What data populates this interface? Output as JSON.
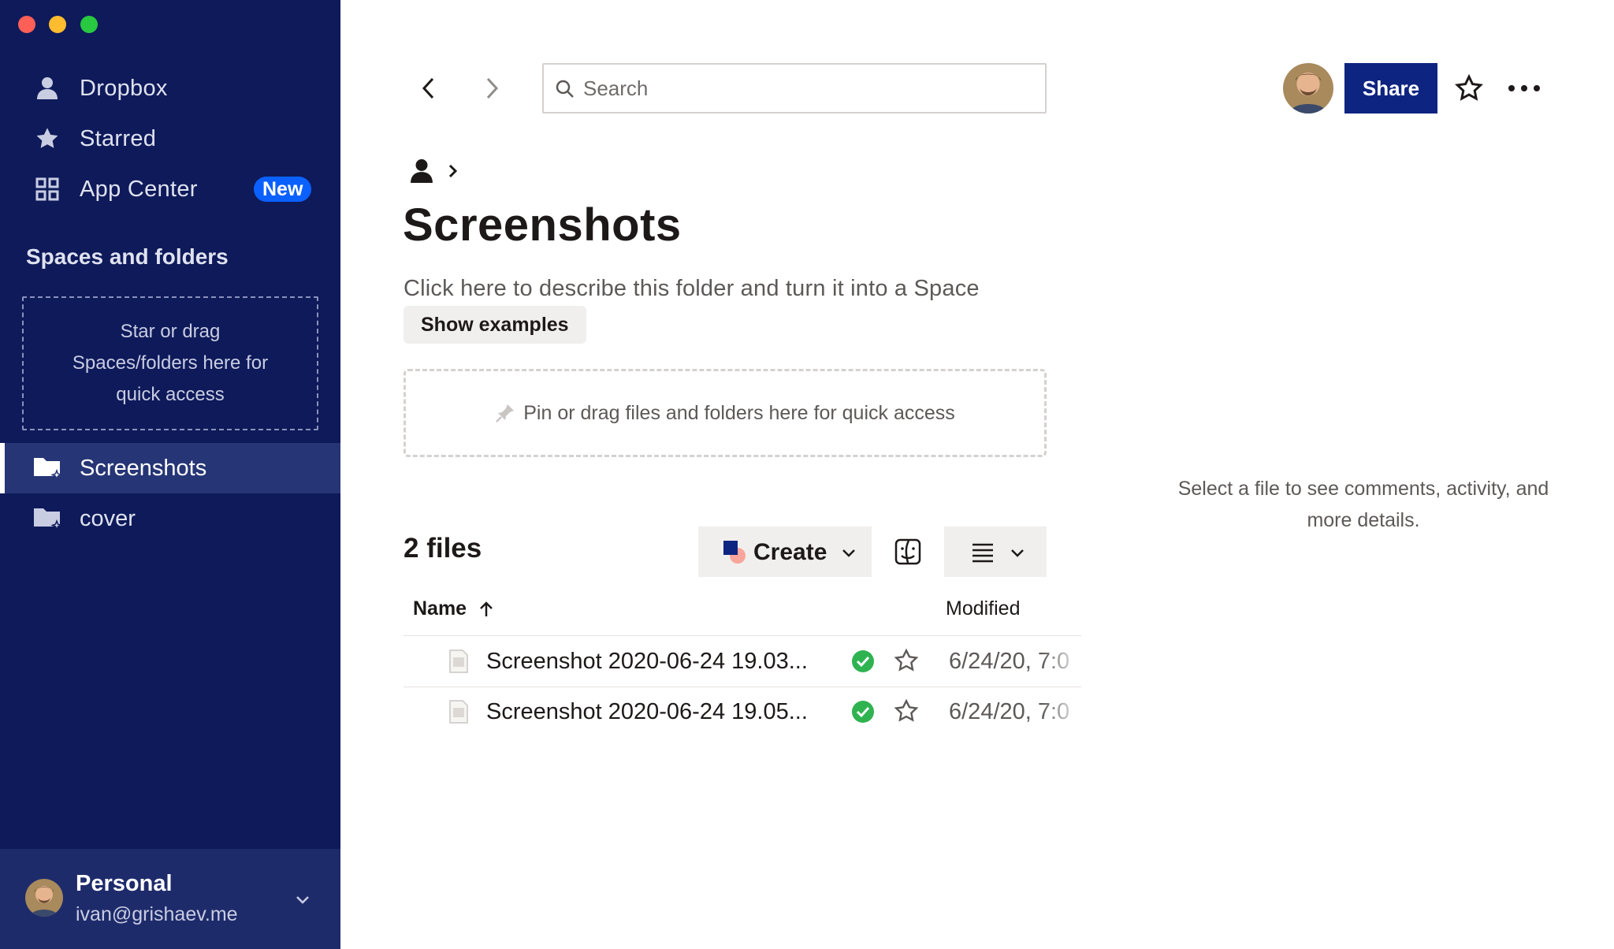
{
  "window": {
    "controls": [
      "close",
      "minimize",
      "maximize"
    ]
  },
  "sidebar": {
    "nav": [
      {
        "label": "Dropbox",
        "icon": "person-icon"
      },
      {
        "label": "Starred",
        "icon": "star-icon"
      },
      {
        "label": "App Center",
        "icon": "apps-grid-icon",
        "badge": "New"
      }
    ],
    "section_title": "Spaces and folders",
    "drop_hint": "Star or drag Spaces/folders here for quick access",
    "folders": [
      {
        "label": "Screenshots",
        "icon": "shared-folder-icon",
        "active": true
      },
      {
        "label": "cover",
        "icon": "shared-folder-icon",
        "active": false
      }
    ],
    "account": {
      "name": "Personal",
      "email": "ivan@grishaev.me"
    }
  },
  "toolbar": {
    "search_placeholder": "Search",
    "share_label": "Share"
  },
  "breadcrumb": {
    "root_icon": "person-icon"
  },
  "folder": {
    "title": "Screenshots",
    "description": "Click here to describe this folder and turn it into a Space",
    "examples_label": "Show examples",
    "pin_hint": "Pin or drag files and folders here for quick access"
  },
  "files": {
    "count_label": "2 files",
    "create_label": "Create",
    "columns": {
      "name": "Name",
      "modified": "Modified"
    },
    "rows": [
      {
        "name": "Screenshot 2020-06-24 19.03...",
        "modified": "6/24/20, 7:0",
        "synced": true
      },
      {
        "name": "Screenshot 2020-06-24 19.05...",
        "modified": "6/24/20, 7:0",
        "synced": true
      }
    ]
  },
  "details": {
    "hint": "Select a file to see comments, activity, and more details."
  },
  "colors": {
    "sidebar_bg": "#0e1a5a",
    "sidebar_active": "#263575",
    "account_bg": "#1e2b6b",
    "accent": "#0d2481",
    "badge": "#0b61ff",
    "sync_ok": "#2fb350"
  }
}
